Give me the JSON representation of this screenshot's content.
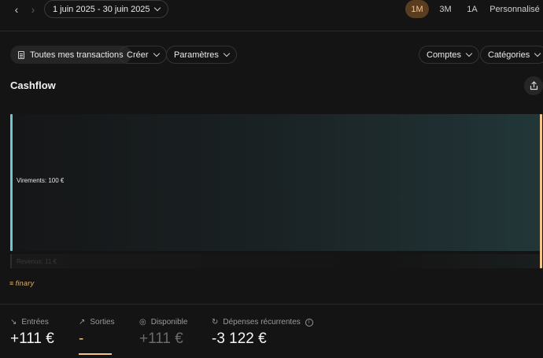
{
  "header": {
    "date_range": "1 juin 2025 - 30 juin 2025",
    "periods": [
      "1M",
      "3M",
      "1A",
      "Personnalisé"
    ],
    "active_period": "1M"
  },
  "toolbar": {
    "all_transactions": "Toutes mes transactions",
    "create": "Créer",
    "settings": "Paramètres",
    "accounts": "Comptes",
    "categories": "Catégories"
  },
  "cashflow": {
    "title": "Cashflow",
    "flows": [
      {
        "label": "Virements: 100 €",
        "value": 100
      },
      {
        "label": "Revenus: 11 €",
        "value": 11
      }
    ]
  },
  "brand": "finary",
  "stats": {
    "in": {
      "label": "Entrées",
      "value": "+111 €"
    },
    "out": {
      "label": "Sorties",
      "value": "-"
    },
    "available": {
      "label": "Disponible",
      "value": "+111 €"
    },
    "recurring": {
      "label": "Dépenses récurrentes",
      "value": "-3 122 €"
    }
  },
  "colors": {
    "accent": "#f2c48c",
    "inflow_node": "#6fc4d4",
    "background": "#141414"
  }
}
